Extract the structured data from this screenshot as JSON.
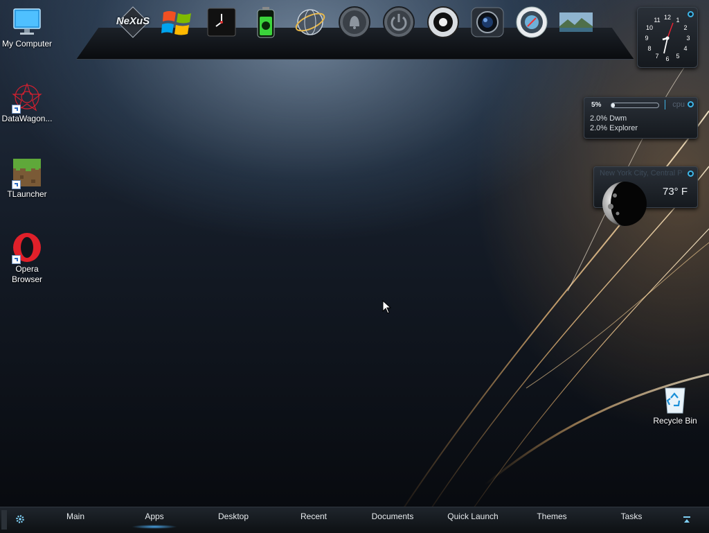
{
  "desktop": {
    "icons": [
      {
        "label": "My Computer"
      },
      {
        "label": "DataWagon..."
      },
      {
        "label": "TLauncher"
      },
      {
        "label": "Opera Browser"
      },
      {
        "label": "Recycle Bin"
      }
    ]
  },
  "dock": {
    "items": [
      {
        "icon": "nexus-logo-icon",
        "label": "NeXuS"
      },
      {
        "icon": "windows-logo-icon"
      },
      {
        "icon": "clock-icon"
      },
      {
        "icon": "battery-icon"
      },
      {
        "icon": "network-globe-icon"
      },
      {
        "icon": "bell-icon"
      },
      {
        "icon": "power-icon"
      },
      {
        "icon": "speaker-icon"
      },
      {
        "icon": "camera-icon"
      },
      {
        "icon": "compass-icon"
      },
      {
        "icon": "landscape-image-icon"
      }
    ]
  },
  "clock_widget": {
    "numbers": [
      "12",
      "1",
      "2",
      "3",
      "4",
      "5",
      "6",
      "7",
      "8",
      "9",
      "10",
      "11"
    ]
  },
  "cpu_widget": {
    "percent_label": "5%",
    "percent_value": 0.05,
    "title": "cpu",
    "processes": [
      "2.0% Dwm",
      "2.0% Explorer"
    ]
  },
  "weather_widget": {
    "location": "New York City, Central P",
    "temperature": "73° F"
  },
  "taskbar": {
    "tabs": [
      "Main",
      "Apps",
      "Desktop",
      "Recent",
      "Documents",
      "Quick Launch",
      "Themes",
      "Tasks"
    ],
    "active_tab": "Apps"
  },
  "colors": {
    "accent": "#3fb6e8",
    "active_glow": "#50b4ff"
  }
}
